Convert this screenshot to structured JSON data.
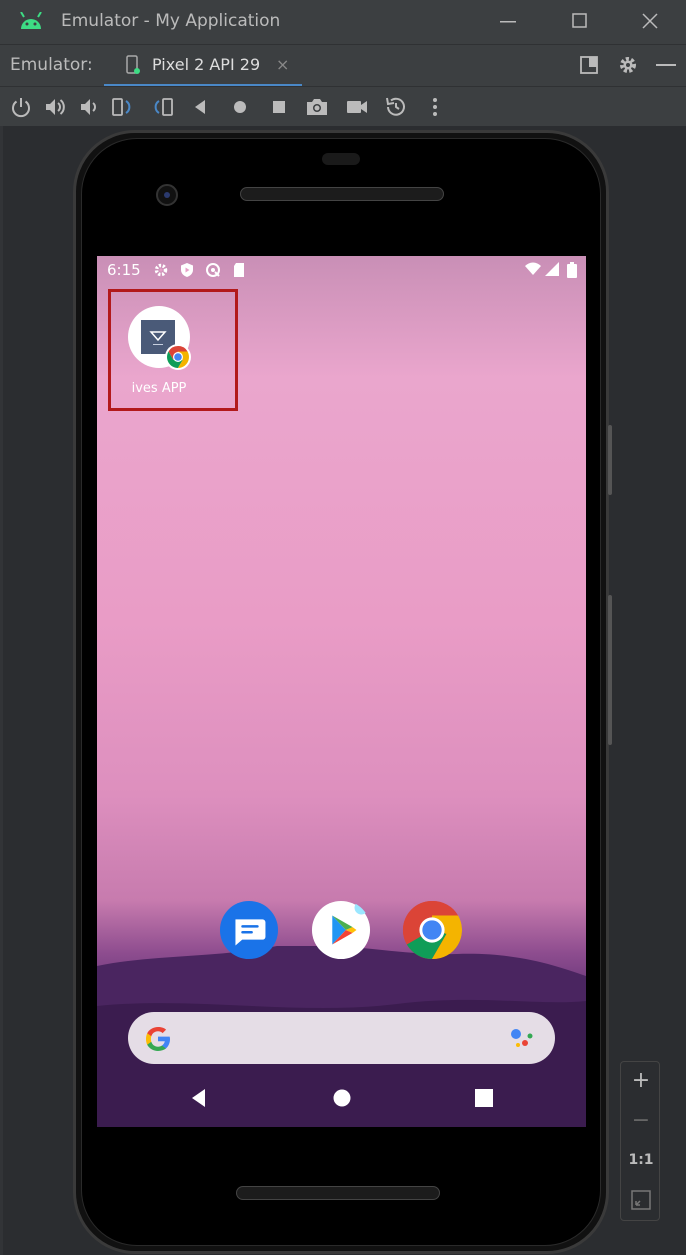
{
  "window": {
    "title": "Emulator - My Application"
  },
  "tabbar": {
    "label": "Emulator:",
    "active_tab": "Pixel 2 API 29",
    "close_glyph": "×"
  },
  "toolbar": {
    "icons": [
      "power-icon",
      "volume-up-icon",
      "volume-down-icon",
      "rotate-left-icon",
      "rotate-right-icon",
      "back-icon",
      "home-icon",
      "overview-icon",
      "camera-icon",
      "video-icon",
      "snapshot-icon",
      "more-icon"
    ]
  },
  "device": {
    "statusbar": {
      "time": "6:15"
    },
    "app": {
      "label": "ives APP"
    },
    "dock": [
      "messages-app-icon",
      "play-store-app-icon",
      "chrome-app-icon"
    ]
  },
  "zoom": {
    "in": "+",
    "out": "−",
    "actual": "1:1"
  },
  "colors": {
    "ide_bg": "#2b2d30",
    "titlebar": "#3c3f41",
    "accent": "#4a88c7",
    "highlight": "#b2191b"
  }
}
